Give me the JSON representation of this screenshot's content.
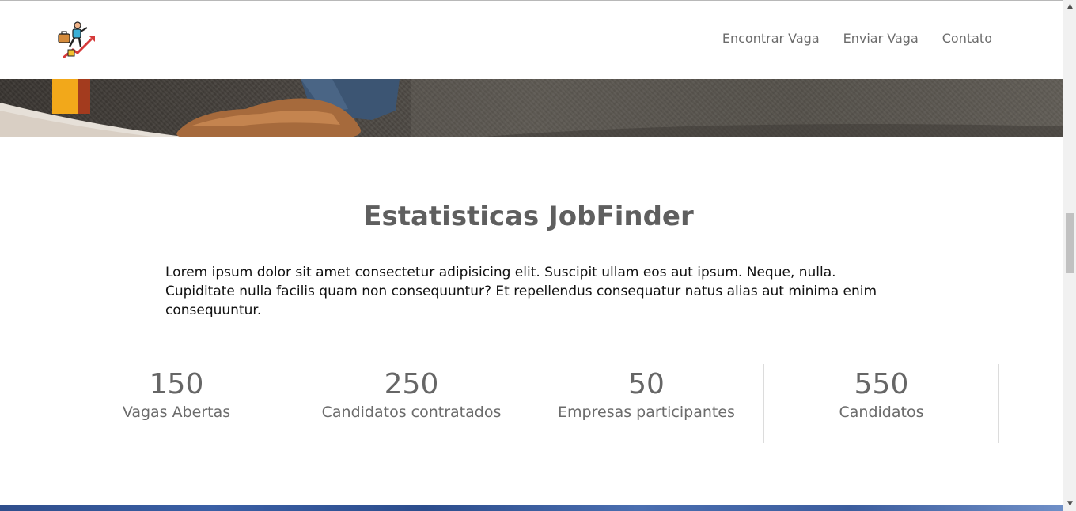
{
  "nav": {
    "items": [
      "Encontrar Vaga",
      "Enviar Vaga",
      "Contato"
    ]
  },
  "logo": {
    "icon": "climbing-career-growth-icon"
  },
  "stats_section": {
    "title": "Estatisticas JobFinder",
    "description": "Lorem ipsum dolor sit amet consectetur adipisicing elit. Suscipit ullam eos aut ipsum. Neque, nulla. Cupiditate nulla facilis quam non consequuntur? Et repellendus consequatur natus alias aut minima enim consequuntur.",
    "stats": [
      {
        "value": "150",
        "label": "Vagas Abertas"
      },
      {
        "value": "250",
        "label": "Candidatos contratados"
      },
      {
        "value": "50",
        "label": "Empresas participantes"
      },
      {
        "value": "550",
        "label": "Candidatos"
      }
    ]
  },
  "colors": {
    "heading": "#5f5f5f",
    "nav_text": "#6b6b6b",
    "stat_text": "#666666"
  },
  "scrollbar": {
    "up_icon": "triangle-up-icon",
    "down_icon": "triangle-down-icon"
  }
}
